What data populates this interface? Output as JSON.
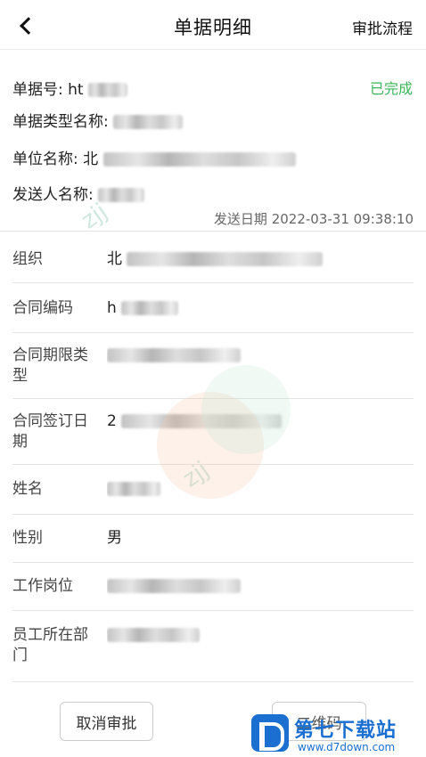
{
  "header": {
    "title": "单据明细",
    "right_action": "审批流程"
  },
  "doc": {
    "number_label": "单据号: ht",
    "status": "已完成",
    "type_label": "单据类型名称:",
    "unit_label": "单位名称: 北",
    "sender_label": "发送人名称:",
    "send_date": "发送日期 2022-03-31 09:38:10"
  },
  "rows": [
    {
      "label": "组织",
      "value": "北"
    },
    {
      "label": "合同编码",
      "value": "h"
    },
    {
      "label": "合同期限类型",
      "value": ""
    },
    {
      "label": "合同签订日期",
      "value": "2"
    },
    {
      "label": "姓名",
      "value": ""
    },
    {
      "label": "性别",
      "value": "男"
    },
    {
      "label": "工作岗位",
      "value": ""
    },
    {
      "label": "员工所在部门",
      "value": ""
    }
  ],
  "footer": {
    "cancel": "取消审批",
    "second": "二维码"
  },
  "watermark": {
    "text": "zjj",
    "brand_name": "第七下载站",
    "brand_url": "www.d7down.com"
  }
}
